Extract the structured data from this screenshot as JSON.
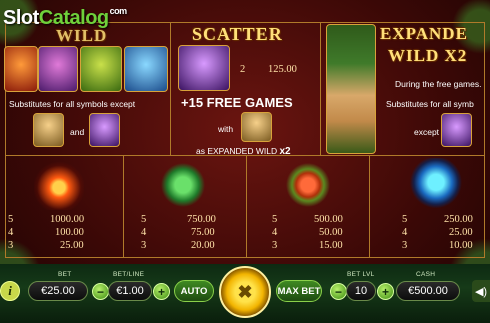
{
  "logo": {
    "part1": "Slot",
    "part2": "Catalog",
    "part3": "com"
  },
  "wild": {
    "title": "WILD",
    "desc": "Substitutes for all symbols except",
    "and": "and"
  },
  "scatter": {
    "title": "SCATTER",
    "count": "2",
    "pay": "125.00",
    "free_games": "+15 FREE GAMES",
    "with": "with",
    "as_expanded": "as EXPANDED WILD",
    "multiplier": "x2"
  },
  "expanded": {
    "title_line1": "EXPANDE",
    "title_line2": "WILD X2",
    "during": "During the free games.",
    "desc": "Substitutes for all symb",
    "except": "except"
  },
  "paytable": [
    {
      "icon": "fire-crystal-icon",
      "rows": [
        [
          "5",
          "1000.00"
        ],
        [
          "4",
          "100.00"
        ],
        [
          "3",
          "25.00"
        ]
      ]
    },
    {
      "icon": "emerald-chest-icon",
      "rows": [
        [
          "5",
          "750.00"
        ],
        [
          "4",
          "75.00"
        ],
        [
          "3",
          "20.00"
        ]
      ]
    },
    {
      "icon": "red-jewel-icon",
      "rows": [
        [
          "5",
          "500.00"
        ],
        [
          "4",
          "50.00"
        ],
        [
          "3",
          "15.00"
        ]
      ]
    },
    {
      "icon": "blue-cauldron-icon",
      "rows": [
        [
          "5",
          "250.00"
        ],
        [
          "4",
          "25.00"
        ],
        [
          "3",
          "10.00"
        ]
      ]
    }
  ],
  "controls": {
    "info": "i",
    "bet_label": "BET",
    "bet_value": "€25.00",
    "betline_label": "BET/LINE",
    "betline_value": "€1.00",
    "auto": "AUTO",
    "spin": "✖",
    "maxbet": "MAX BET",
    "betlvl_label": "BET LVL",
    "betlvl_value": "10",
    "cash_label": "CASH",
    "cash_value": "€500.00",
    "minus": "−",
    "plus": "+",
    "sound": "◀)"
  }
}
